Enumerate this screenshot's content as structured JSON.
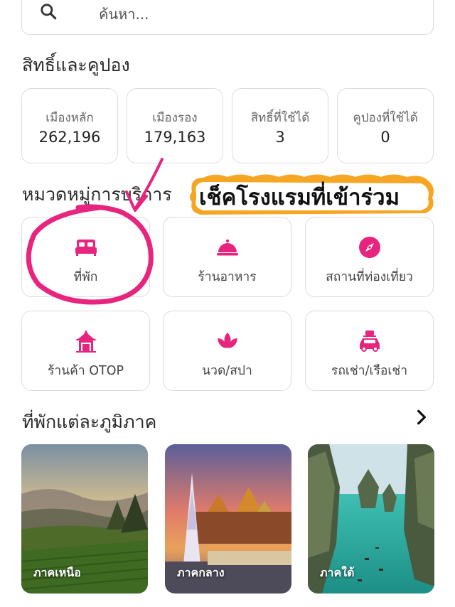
{
  "search": {
    "placeholder": "ค้นหา..."
  },
  "rights": {
    "title": "สิทธิ์และคูปอง",
    "stats": [
      {
        "label": "เมืองหลัก",
        "value": "262,196"
      },
      {
        "label": "เมืองรอง",
        "value": "179,163"
      },
      {
        "label": "สิทธิ์ที่ใช้ได้",
        "value": "3"
      },
      {
        "label": "คูปองที่ใช้ได้",
        "value": "0"
      }
    ]
  },
  "categories": {
    "title": "หมวดหมู่การบริการ",
    "items": [
      {
        "label": "ที่พัก",
        "icon": "bed-icon"
      },
      {
        "label": "ร้านอาหาร",
        "icon": "food-cloche-icon"
      },
      {
        "label": "สถานที่ท่องเที่ยว",
        "icon": "compass-icon"
      },
      {
        "label": "ร้านค้า OTOP",
        "icon": "thai-pavilion-icon"
      },
      {
        "label": "นวด/สปา",
        "icon": "lotus-icon"
      },
      {
        "label": "รถเช่า/เรือเช่า",
        "icon": "car-luggage-icon"
      }
    ]
  },
  "regions": {
    "title": "ที่พักแต่ละภูมิภาค",
    "items": [
      {
        "label": "ภาคเหนือ"
      },
      {
        "label": "ภาคกลาง"
      },
      {
        "label": "ภาคใต้"
      }
    ]
  },
  "overlay": {
    "banner_text": "เช็คโรงแรมที่เข้าร่วม"
  },
  "colors": {
    "accent": "#e8257e",
    "border": "#dcdcdc",
    "banner": "#f6a623"
  }
}
